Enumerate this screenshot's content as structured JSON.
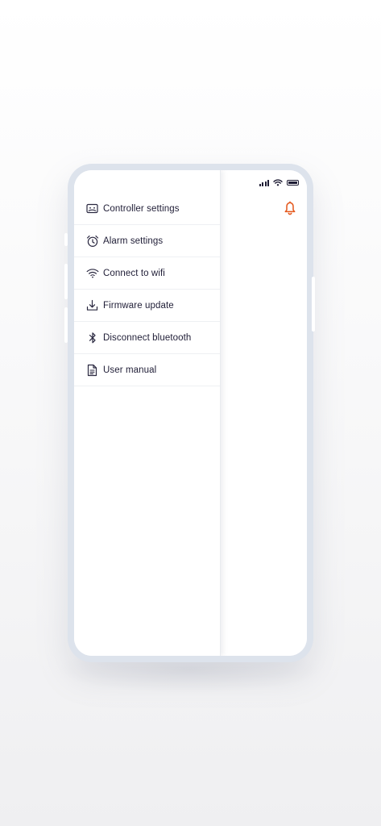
{
  "menu": {
    "items": [
      {
        "label": "Controller settings",
        "icon": "controller-icon"
      },
      {
        "label": "Alarm settings",
        "icon": "alarm-clock-icon"
      },
      {
        "label": "Connect to wifi",
        "icon": "wifi-icon"
      },
      {
        "label": "Firmware update",
        "icon": "download-icon"
      },
      {
        "label": "Disconnect bluetooth",
        "icon": "bluetooth-icon"
      },
      {
        "label": "User manual",
        "icon": "document-icon"
      }
    ]
  },
  "colors": {
    "accent": "#e4571b",
    "text": "#1f1d36",
    "phone_frame": "#dde3ec"
  }
}
